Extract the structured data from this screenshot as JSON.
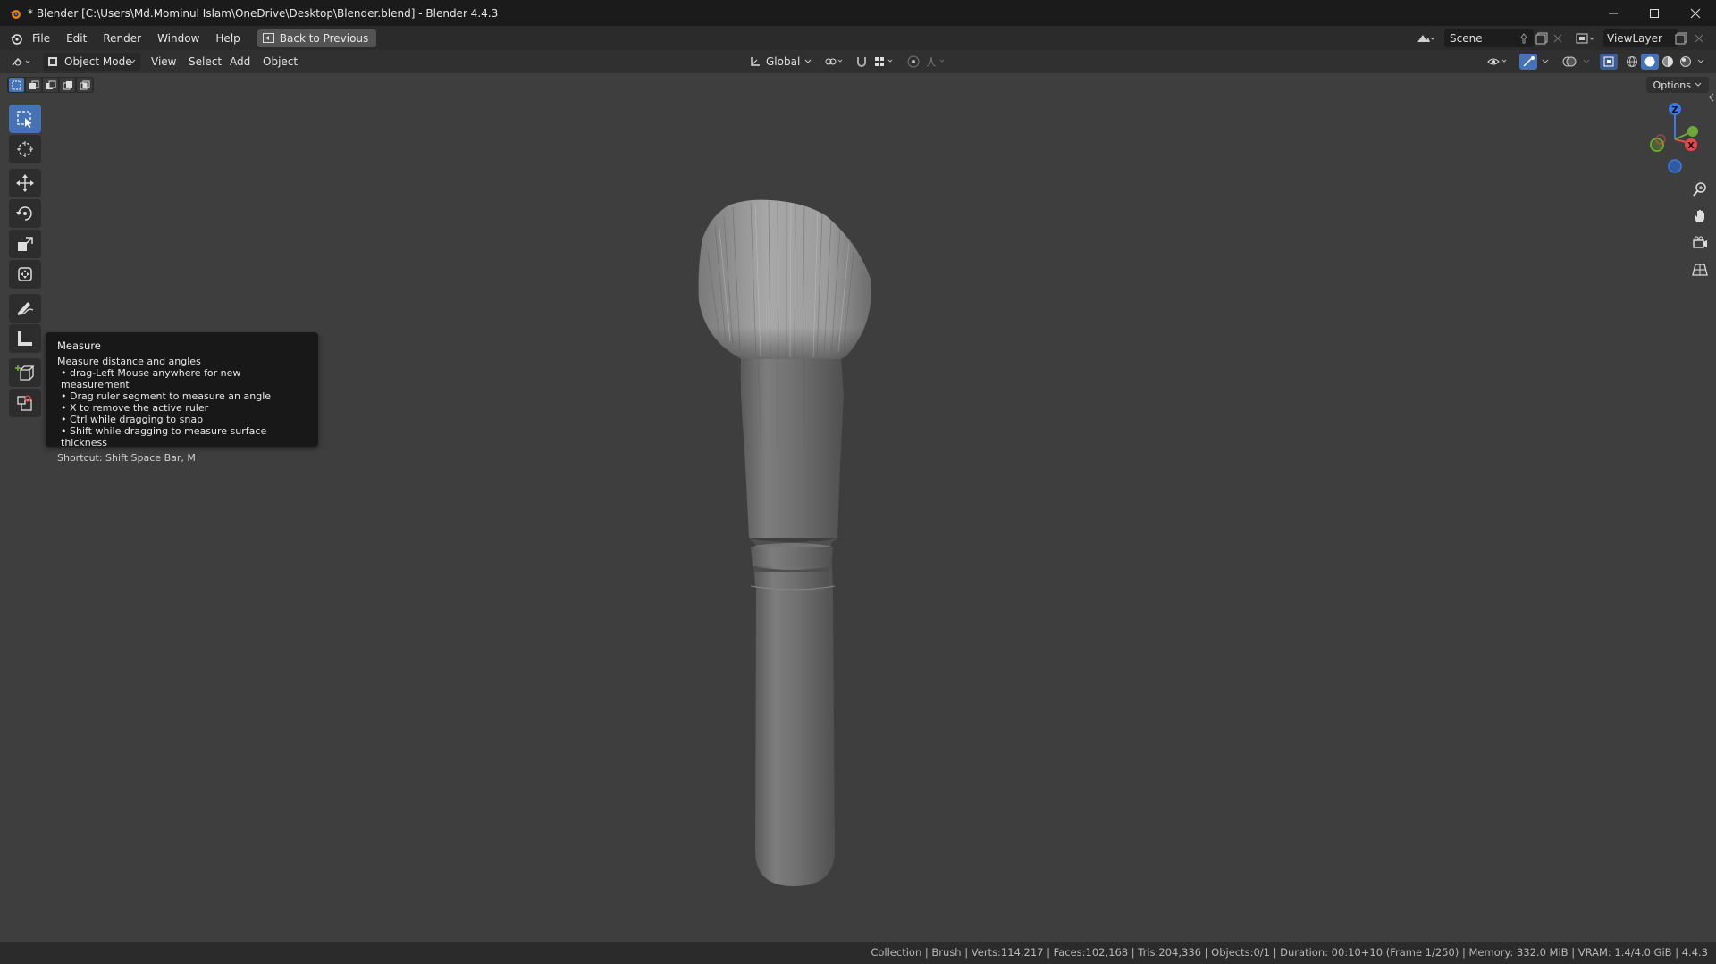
{
  "window": {
    "title": "* Blender [C:\\Users\\Md.Mominul Islam\\OneDrive\\Desktop\\Blender.blend] - Blender 4.4.3"
  },
  "topbar": {
    "menus": [
      "File",
      "Edit",
      "Render",
      "Window",
      "Help"
    ],
    "back_button": "Back to Previous",
    "scene": "Scene",
    "view_layer": "ViewLayer"
  },
  "viewport_header": {
    "mode": "Object Mode",
    "menus": [
      "View",
      "Select",
      "Add",
      "Object"
    ],
    "orientation": "Global"
  },
  "viewport": {
    "options_label": "Options",
    "gizmo_axes": {
      "z": "Z",
      "x": "X"
    }
  },
  "tooltip": {
    "title": "Measure",
    "description": "Measure distance and angles",
    "bullets": [
      "• drag-Left Mouse anywhere for new measurement",
      "• Drag ruler segment to measure an angle",
      "• X to remove the active ruler",
      "• Ctrl while dragging to snap",
      "• Shift while dragging to measure surface thickness"
    ],
    "shortcut": "Shortcut: Shift Space Bar, M"
  },
  "statusbar": {
    "text": "Collection | Brush | Verts:114,217 | Faces:102,168 | Tris:204,336 | Objects:0/1 | Duration: 00:10+10 (Frame 1/250) | Memory: 332.0 MiB | VRAM: 1.4/4.0 GiB | 4.4.3"
  },
  "colors": {
    "accent": "#4772b3",
    "viewport_bg": "#3e3e3e",
    "axis_x": "#e04b4b",
    "axis_y": "#6ea63a",
    "axis_z": "#3c7be0"
  }
}
